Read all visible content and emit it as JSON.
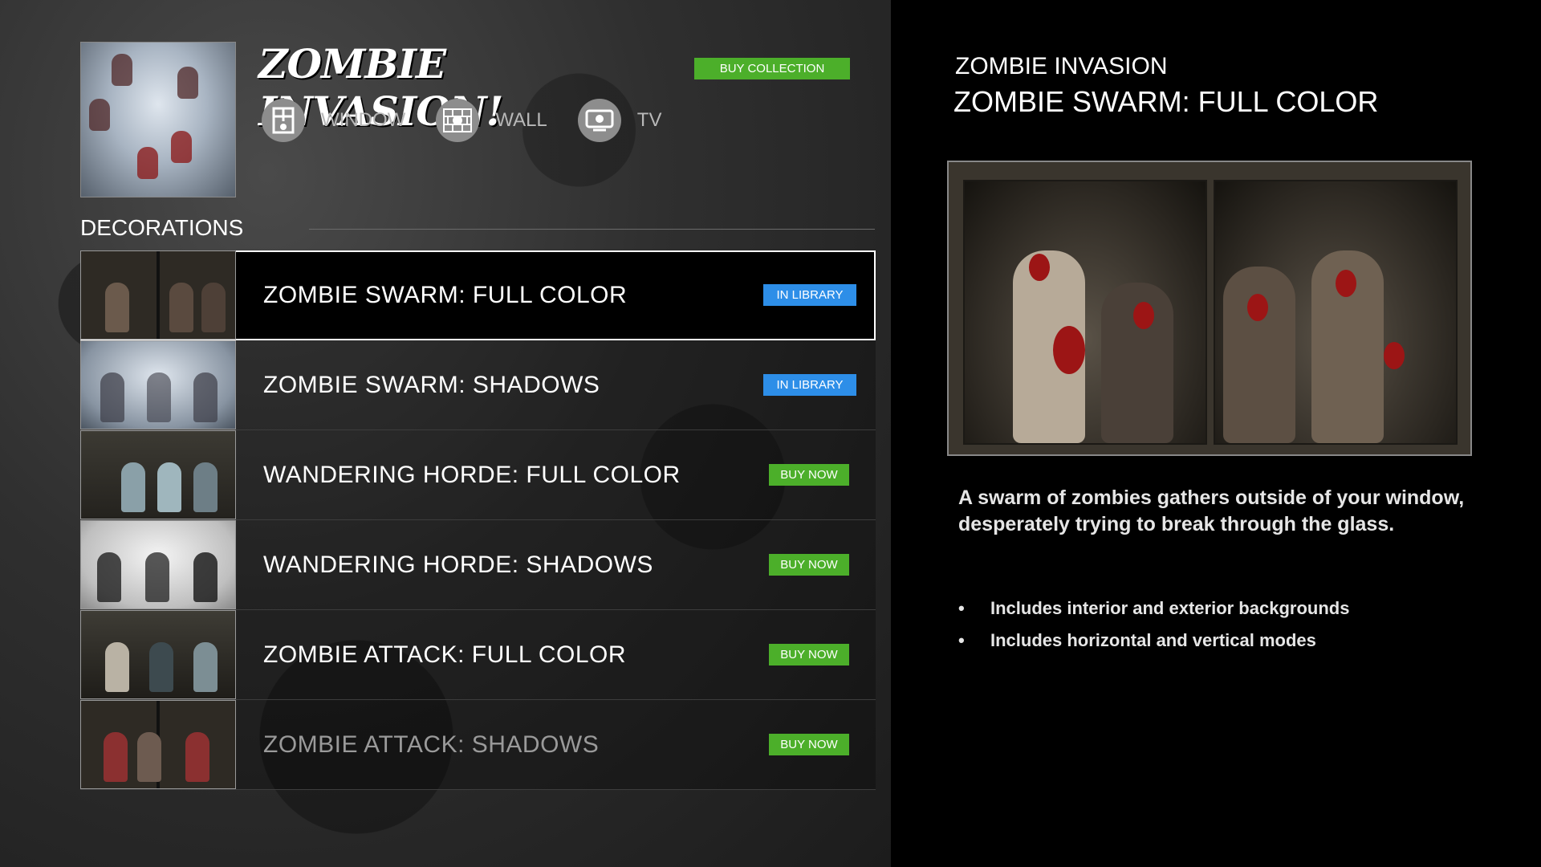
{
  "collection": {
    "logo_text": "ZOMBIE INVASION!",
    "buy_collection_label": "BUY COLLECTION",
    "modes": [
      {
        "label": "WINDOW",
        "icon": "window-icon"
      },
      {
        "label": "WALL",
        "icon": "wall-icon"
      },
      {
        "label": "TV",
        "icon": "tv-icon"
      }
    ]
  },
  "decorations": {
    "heading": "DECORATIONS",
    "items": [
      {
        "title": "ZOMBIE SWARM: FULL COLOR",
        "badge": "IN LIBRARY",
        "status": "library",
        "selected": true
      },
      {
        "title": "ZOMBIE SWARM: SHADOWS",
        "badge": "IN LIBRARY",
        "status": "library",
        "selected": false
      },
      {
        "title": "WANDERING HORDE: FULL COLOR",
        "badge": "BUY NOW",
        "status": "buy",
        "selected": false
      },
      {
        "title": "WANDERING HORDE: SHADOWS",
        "badge": "BUY NOW",
        "status": "buy",
        "selected": false
      },
      {
        "title": "ZOMBIE ATTACK: FULL COLOR",
        "badge": "BUY NOW",
        "status": "buy",
        "selected": false
      },
      {
        "title": "ZOMBIE ATTACK: SHADOWS",
        "badge": "BUY NOW",
        "status": "buy",
        "selected": false
      }
    ]
  },
  "detail": {
    "series": "ZOMBIE INVASION",
    "title": "ZOMBIE SWARM: FULL COLOR",
    "description": "A swarm of zombies gathers outside of your window, desperately trying to break through the glass.",
    "features": [
      "Includes interior and exterior backgrounds",
      "Includes horizontal and vertical modes"
    ]
  },
  "colors": {
    "buy_green": "#4caf2a",
    "library_blue": "#2d8ee8",
    "selected_outline": "#ffffff"
  }
}
